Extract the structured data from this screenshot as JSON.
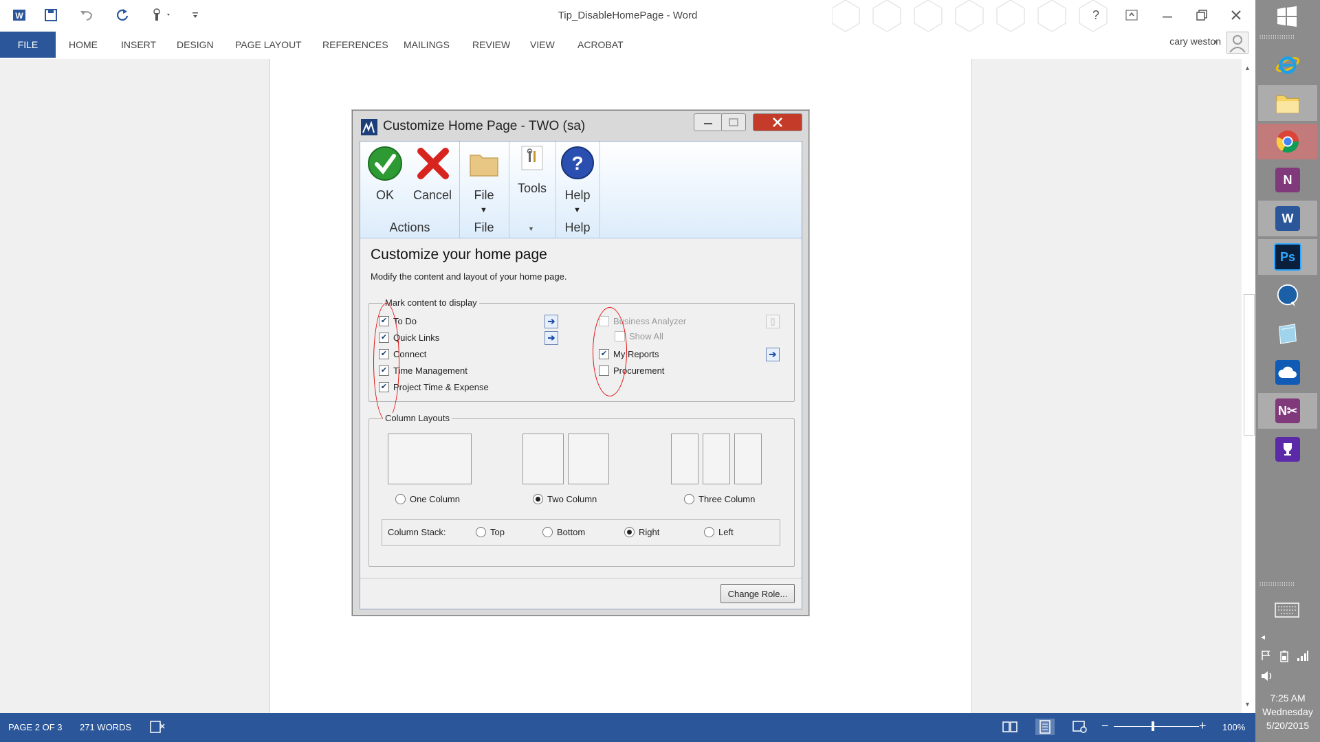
{
  "app": {
    "doc_title": "Tip_DisableHomePage - Word",
    "help_glyph": "?",
    "tabs": [
      "FILE",
      "HOME",
      "INSERT",
      "DESIGN",
      "PAGE LAYOUT",
      "REFERENCES",
      "MAILINGS",
      "REVIEW",
      "VIEW",
      "ACROBAT"
    ],
    "user": "cary weston",
    "status": {
      "page": "PAGE 2 OF 3",
      "words": "271 WORDS",
      "zoom": "100%"
    }
  },
  "taskbar": {
    "clock_time": "7:25 AM",
    "clock_day": "Wednesday",
    "clock_date": "5/20/2015",
    "apps": [
      "internet-explorer",
      "file-explorer",
      "chrome",
      "onenote",
      "word",
      "photoshop",
      "messenger",
      "reader",
      "onedrive",
      "onenote-clipper",
      "trophy"
    ]
  },
  "dialog": {
    "title": "Customize Home Page  -  TWO (sa)",
    "ribbon": {
      "ok": "OK",
      "cancel": "Cancel",
      "actions_group": "Actions",
      "file_btn": "File",
      "file_group": "File",
      "tools_btn": "Tools",
      "help_btn": "Help",
      "help_group": "Help"
    },
    "heading": "Customize your home page",
    "subtitle": "Modify the content and layout of your home page.",
    "content_group": "Mark content to display",
    "left_items": [
      {
        "label": "To Do",
        "checked": true
      },
      {
        "label": "Quick Links",
        "checked": true
      },
      {
        "label": "Connect",
        "checked": true
      },
      {
        "label": "Time Management",
        "checked": true
      },
      {
        "label": "Project Time & Expense",
        "checked": true
      }
    ],
    "right_items": [
      {
        "label": "Business Analyzer",
        "checked": false,
        "disabled": true
      },
      {
        "label": "Show All",
        "checked": false,
        "disabled": true
      },
      {
        "label": "My Reports",
        "checked": true
      },
      {
        "label": "Procurement",
        "checked": false
      }
    ],
    "layouts_group": "Column Layouts",
    "layouts": [
      {
        "label": "One Column",
        "selected": false
      },
      {
        "label": "Two Column",
        "selected": true
      },
      {
        "label": "Three Column",
        "selected": false
      }
    ],
    "stack_label": "Column Stack:",
    "stack_options": [
      {
        "label": "Top",
        "selected": false
      },
      {
        "label": "Bottom",
        "selected": false
      },
      {
        "label": "Right",
        "selected": true
      },
      {
        "label": "Left",
        "selected": false
      }
    ],
    "change_role": "Change Role..."
  }
}
